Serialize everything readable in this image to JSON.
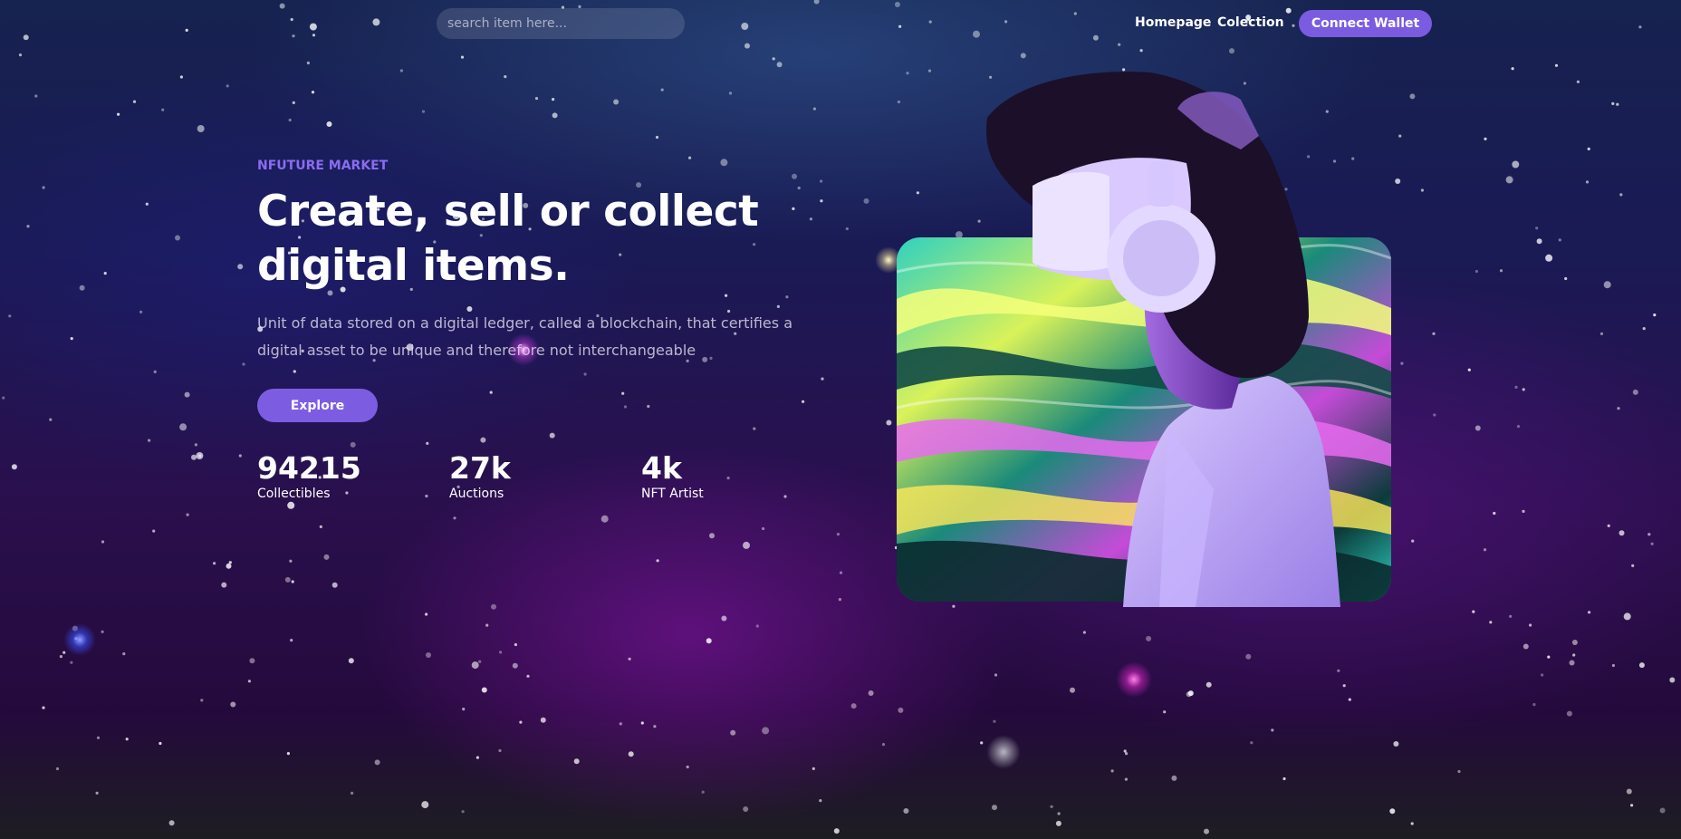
{
  "nav": {
    "search_placeholder": "search item here...",
    "links": [
      "Homepage",
      "Colection"
    ],
    "wallet_label": "Connect Wallet"
  },
  "hero": {
    "eyebrow": "NFUTURE MARKET",
    "title_line1": "Create, sell or collect",
    "title_line2": "digital items.",
    "subtitle_line1": "Unit of data stored on a digital ledger, called a blockchain, that certifies a",
    "subtitle_line2": "digital asset to be unique and therefore not interchangeable",
    "cta_label": "Explore"
  },
  "stats": [
    {
      "value": "94215",
      "label": "Collectibles"
    },
    {
      "value": "27k",
      "label": "Auctions"
    },
    {
      "value": "4k",
      "label": "NFT Artist"
    }
  ],
  "colors": {
    "accent": "#7b5be0",
    "eyebrow": "#8b6cf0",
    "background_top": "#16224f",
    "background_bottom": "#1d1d22"
  }
}
